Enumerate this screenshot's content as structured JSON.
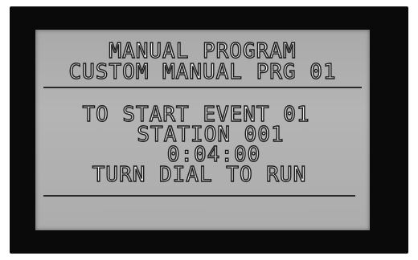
{
  "display": {
    "title_line": "MANUAL PROGRAM",
    "subtitle_line": "CUSTOM MANUAL PRG 01",
    "event_line": "TO START EVENT 01",
    "station_line": "STATION 001",
    "duration_line": "0:04:00",
    "instruction_line": "TURN DIAL TO RUN"
  },
  "colors": {
    "bezel": "#0a0a0a",
    "lcd_background": "#b0b0b0",
    "glyph_fill": "#f2f2f2",
    "glyph_outline": "#1a1a1a"
  }
}
